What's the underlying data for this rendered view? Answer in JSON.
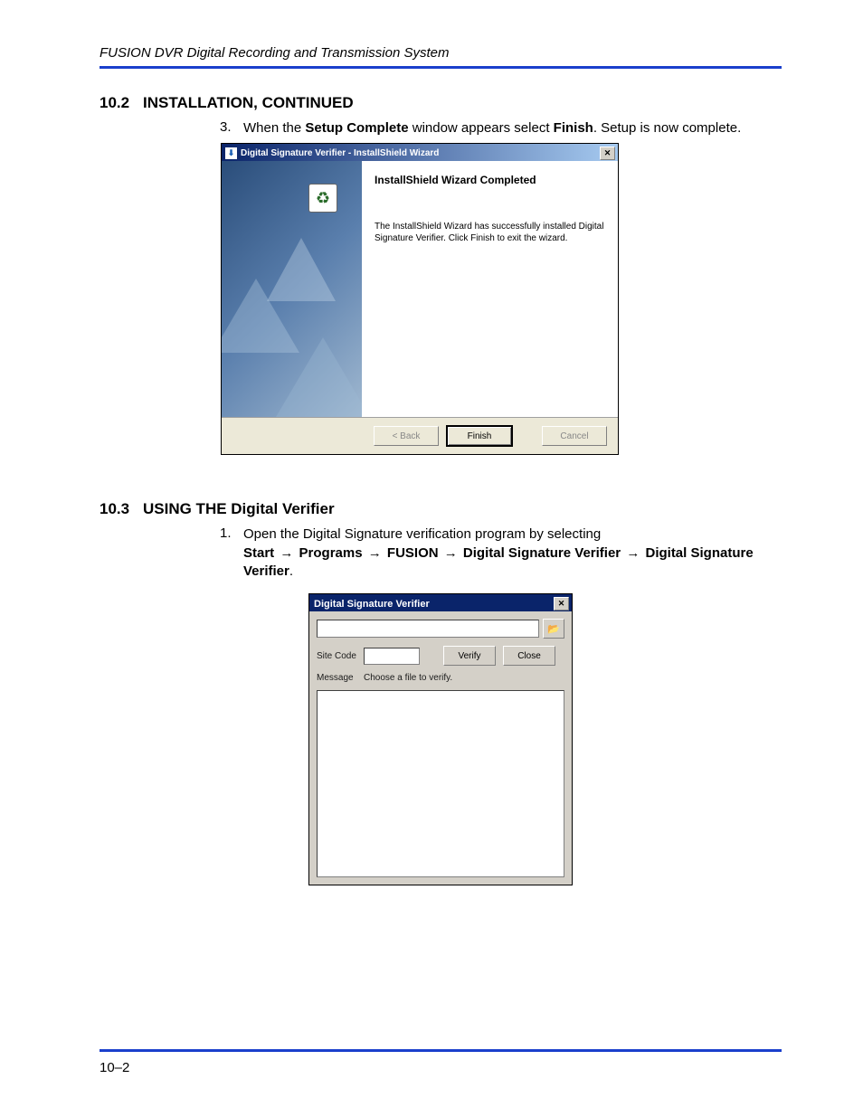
{
  "header": "FUSION DVR Digital Recording and Transmission System",
  "sec1": {
    "num": "10.2",
    "title": "INSTALLATION, CONTINUED",
    "item_num": "3.",
    "text_a": "When the ",
    "text_b": "Setup Complete",
    "text_c": " window appears select ",
    "text_d": "Finish",
    "text_e": ". Setup is now complete."
  },
  "wizard": {
    "title": "Digital Signature Verifier - InstallShield Wizard",
    "heading": "InstallShield Wizard Completed",
    "para": "The InstallShield Wizard has successfully installed Digital Signature Verifier. Click Finish to exit the wizard.",
    "btn_back": "< Back",
    "btn_finish": "Finish",
    "btn_cancel": "Cancel"
  },
  "sec2": {
    "num": "10.3",
    "title": "USING THE Digital Verifier",
    "item_num": "1.",
    "text_a": "Open the Digital Signature verification program by selecting ",
    "p_start": "Start",
    "p_programs": "Programs",
    "p_fusion": "FUSION",
    "p_dsv": "Digital Signature Verifier",
    "p_dsv2": "Digital Signature Verifier",
    "period": "."
  },
  "arrow": "→",
  "verifier": {
    "title": "Digital Signature Verifier",
    "site_code": "Site Code",
    "verify": "Verify",
    "close": "Close",
    "message": "Message",
    "choose": "Choose a file to verify."
  },
  "page_num": "10–2"
}
